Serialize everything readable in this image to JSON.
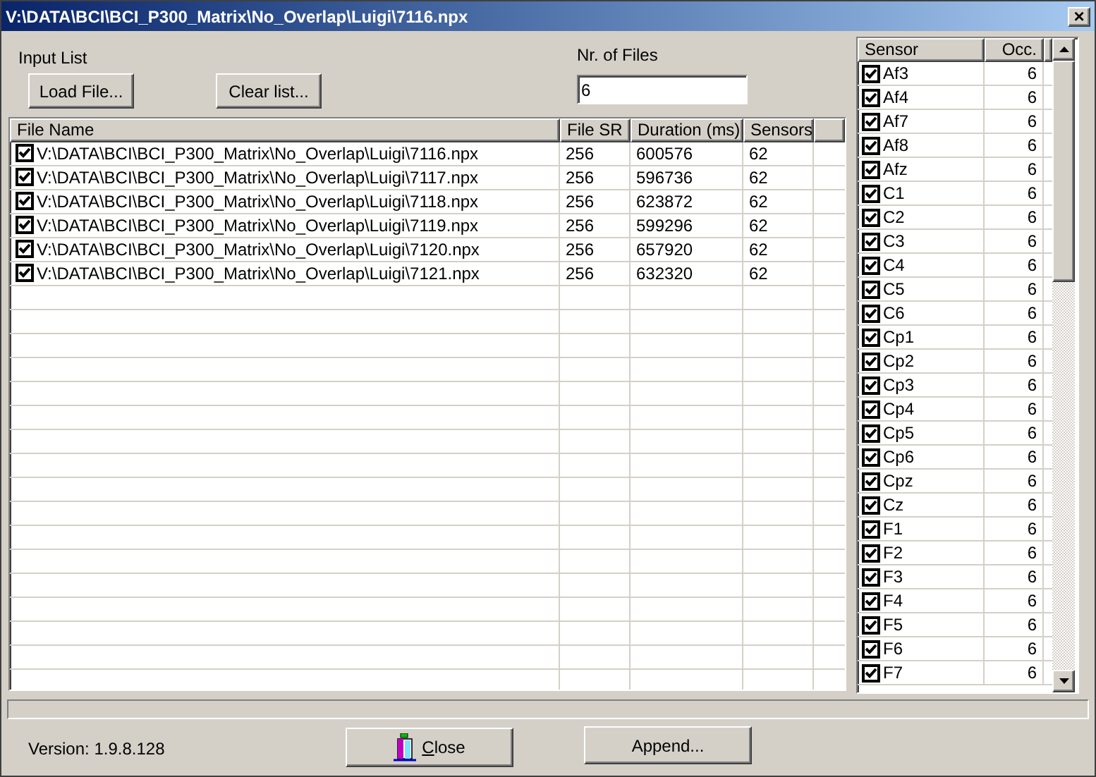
{
  "window": {
    "title": "V:\\DATA\\BCI\\BCI_P300_Matrix\\No_Overlap\\Luigi\\7116.npx",
    "close": "×"
  },
  "input_list": {
    "label": "Input List",
    "buttons": [
      "Load File...",
      "Clear list..."
    ]
  },
  "nr_of_files": {
    "label": "Nr. of Files",
    "value": "6"
  },
  "files": {
    "columns": [
      "File Name",
      "File SR",
      "Duration (ms)",
      "Sensors"
    ],
    "rows": [
      {
        "checked": true,
        "cells": [
          "V:\\DATA\\BCI\\BCI_P300_Matrix\\No_Overlap\\Luigi\\7116.npx",
          "256",
          "600576",
          "62"
        ]
      },
      {
        "checked": true,
        "cells": [
          "V:\\DATA\\BCI\\BCI_P300_Matrix\\No_Overlap\\Luigi\\7117.npx",
          "256",
          "596736",
          "62"
        ]
      },
      {
        "checked": true,
        "cells": [
          "V:\\DATA\\BCI\\BCI_P300_Matrix\\No_Overlap\\Luigi\\7118.npx",
          "256",
          "623872",
          "62"
        ]
      },
      {
        "checked": true,
        "cells": [
          "V:\\DATA\\BCI\\BCI_P300_Matrix\\No_Overlap\\Luigi\\7119.npx",
          "256",
          "599296",
          "62"
        ]
      },
      {
        "checked": true,
        "cells": [
          "V:\\DATA\\BCI\\BCI_P300_Matrix\\No_Overlap\\Luigi\\7120.npx",
          "256",
          "657920",
          "62"
        ]
      },
      {
        "checked": true,
        "cells": [
          "V:\\DATA\\BCI\\BCI_P300_Matrix\\No_Overlap\\Luigi\\7121.npx",
          "256",
          "632320",
          "62"
        ]
      }
    ]
  },
  "sensors": {
    "columns": [
      "Sensor",
      "Occ."
    ],
    "rows": [
      {
        "checked": true,
        "name": "Af3",
        "occ": "6"
      },
      {
        "checked": true,
        "name": "Af4",
        "occ": "6"
      },
      {
        "checked": true,
        "name": "Af7",
        "occ": "6"
      },
      {
        "checked": true,
        "name": "Af8",
        "occ": "6"
      },
      {
        "checked": true,
        "name": "Afz",
        "occ": "6"
      },
      {
        "checked": true,
        "name": "C1",
        "occ": "6"
      },
      {
        "checked": true,
        "name": "C2",
        "occ": "6"
      },
      {
        "checked": true,
        "name": "C3",
        "occ": "6"
      },
      {
        "checked": true,
        "name": "C4",
        "occ": "6"
      },
      {
        "checked": true,
        "name": "C5",
        "occ": "6"
      },
      {
        "checked": true,
        "name": "C6",
        "occ": "6"
      },
      {
        "checked": true,
        "name": "Cp1",
        "occ": "6"
      },
      {
        "checked": true,
        "name": "Cp2",
        "occ": "6"
      },
      {
        "checked": true,
        "name": "Cp3",
        "occ": "6"
      },
      {
        "checked": true,
        "name": "Cp4",
        "occ": "6"
      },
      {
        "checked": true,
        "name": "Cp5",
        "occ": "6"
      },
      {
        "checked": true,
        "name": "Cp6",
        "occ": "6"
      },
      {
        "checked": true,
        "name": "Cpz",
        "occ": "6"
      },
      {
        "checked": true,
        "name": "Cz",
        "occ": "6"
      },
      {
        "checked": true,
        "name": "F1",
        "occ": "6"
      },
      {
        "checked": true,
        "name": "F2",
        "occ": "6"
      },
      {
        "checked": true,
        "name": "F3",
        "occ": "6"
      },
      {
        "checked": true,
        "name": "F4",
        "occ": "6"
      },
      {
        "checked": true,
        "name": "F5",
        "occ": "6"
      },
      {
        "checked": true,
        "name": "F6",
        "occ": "6"
      },
      {
        "checked": true,
        "name": "F7",
        "occ": "6"
      }
    ]
  },
  "version": "Version: 1.9.8.128",
  "buttons": {
    "close": "Close",
    "append": "Append..."
  }
}
